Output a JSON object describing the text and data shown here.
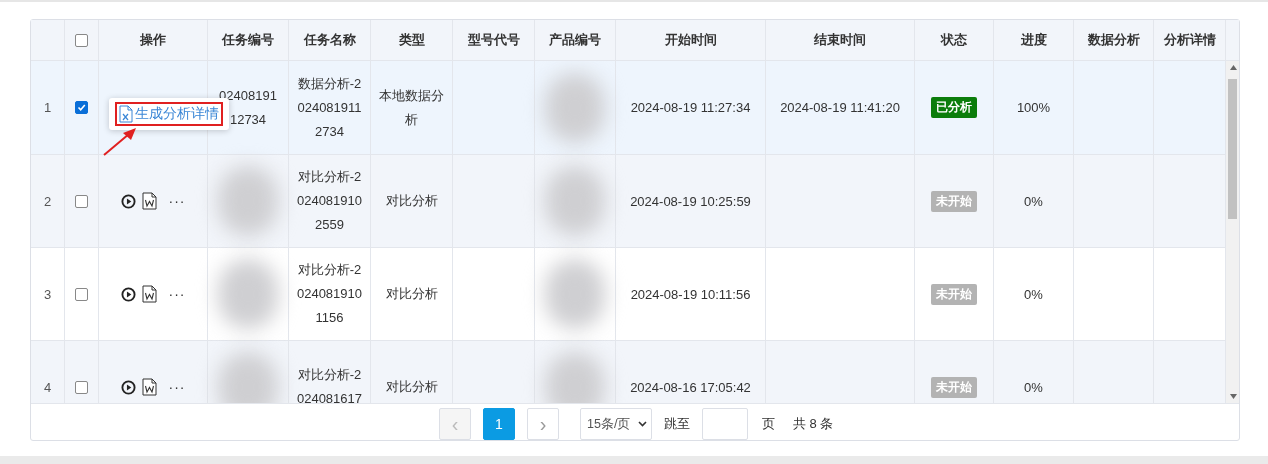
{
  "table": {
    "select_all": {
      "checked": false
    },
    "columns": [
      "",
      "",
      "操作",
      "任务编号",
      "任务名称",
      "类型",
      "型号代号",
      "产品编号",
      "开始时间",
      "结束时间",
      "状态",
      "进度",
      "数据分析",
      "分析详情"
    ],
    "rows": [
      {
        "index": "1",
        "checked": true,
        "task_no": "02408191 12734",
        "task_name": "数据分析-20240819112734",
        "type": "本地数据分析",
        "start": "2024-08-19 11:27:34",
        "end": "2024-08-19 11:41:20",
        "status": {
          "label": "已分析",
          "kind": "done"
        },
        "progress": "100%",
        "popup": {
          "label": "生成分析详情"
        }
      },
      {
        "index": "2",
        "checked": false,
        "task_name": "对比分析-20240819102559",
        "type": "对比分析",
        "start": "2024-08-19 10:25:59",
        "status": {
          "label": "未开始",
          "kind": "pending"
        },
        "progress": "0%",
        "more": "···"
      },
      {
        "index": "3",
        "checked": false,
        "task_name": "对比分析-20240819101156",
        "type": "对比分析",
        "start": "2024-08-19 10:11:56",
        "status": {
          "label": "未开始",
          "kind": "pending"
        },
        "progress": "0%",
        "more": "···"
      },
      {
        "index": "4",
        "checked": false,
        "task_name": "对比分析-2024081617",
        "type": "对比分析",
        "start": "2024-08-16 17:05:42",
        "status": {
          "label": "未开始",
          "kind": "pending"
        },
        "progress": "0%",
        "more": "···"
      }
    ]
  },
  "pagination": {
    "prev": {
      "label": "‹",
      "disabled": true
    },
    "pages": [
      {
        "label": "1",
        "selected": true
      }
    ],
    "next": {
      "label": "›",
      "disabled": false
    },
    "page_size": "15条/页",
    "jump_label": "跳至",
    "page_unit": "页",
    "total": "共 8 条"
  }
}
